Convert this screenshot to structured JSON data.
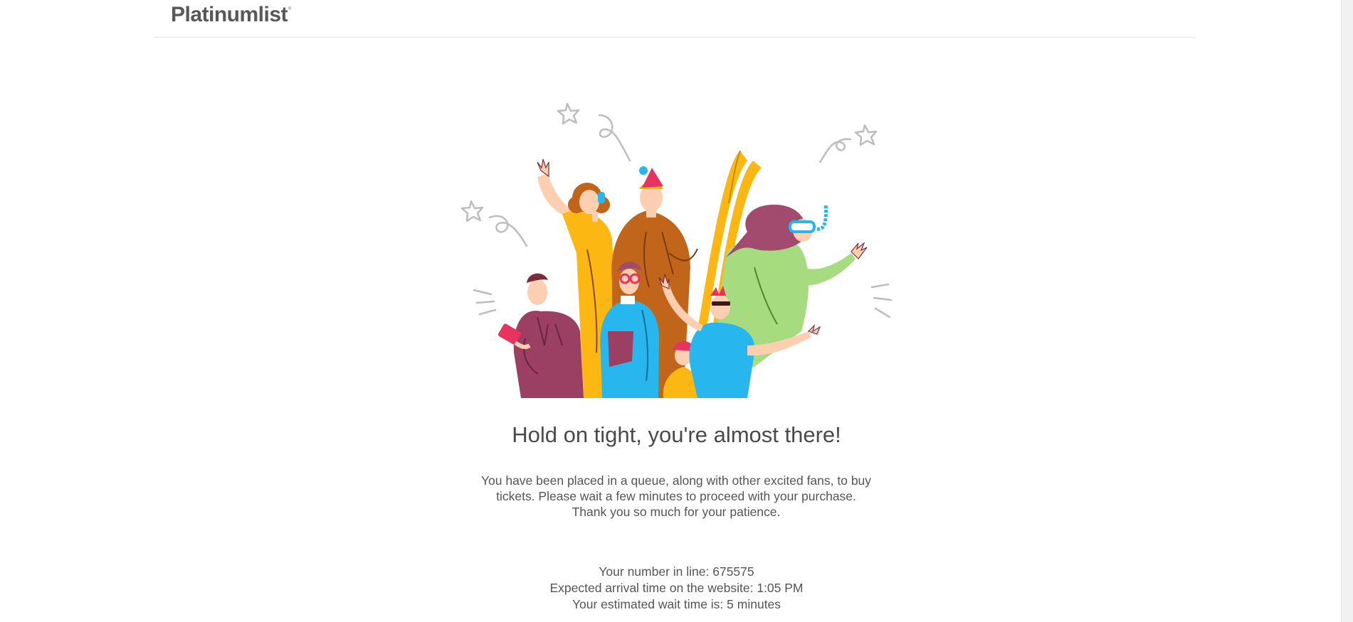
{
  "header": {
    "logo_text": "Platinumlist",
    "logo_mark": "®"
  },
  "illustration": {
    "icon": "celebrating-crowd-illustration",
    "colors": {
      "yellow": "#FDB713",
      "brown": "#C1651A",
      "green": "#A6DB80",
      "blue": "#27B6EE",
      "plum": "#9B3F63",
      "pink": "#E8325F",
      "skin": "#FCCFB0",
      "hair_plum": "#A24B6E",
      "doodle_gray": "#BDBDBD"
    }
  },
  "main": {
    "headline": "Hold on tight, you're almost there!",
    "message_line1": "You have been placed in a queue, along with other excited fans, to buy",
    "message_line2": "tickets. Please wait a few minutes to proceed with your purchase.",
    "message_line3": "Thank you so much for your patience."
  },
  "queue": {
    "number_label": "Your number in line:",
    "number_value": "675575",
    "arrival_label": "Expected arrival time on the website:",
    "arrival_value": "1:05 PM",
    "wait_label": "Your estimated wait time is:",
    "wait_value": "5 minutes"
  }
}
